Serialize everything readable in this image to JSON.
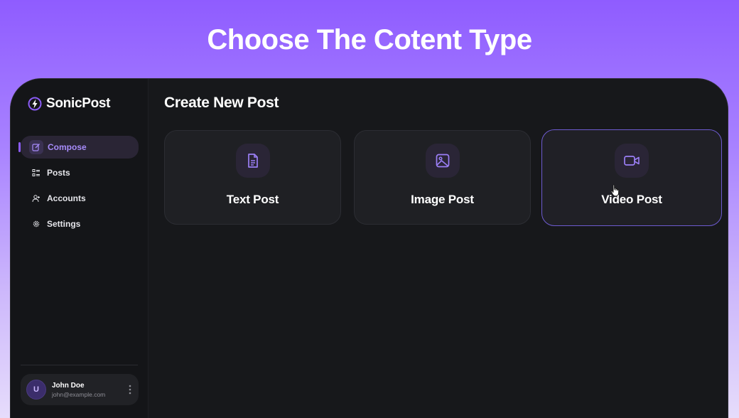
{
  "hero": {
    "title": "Choose The Cotent Type"
  },
  "brand": {
    "name": "SonicPost"
  },
  "nav": {
    "items": [
      {
        "label": "Compose",
        "icon": "edit-icon",
        "active": true
      },
      {
        "label": "Posts",
        "icon": "grid-list-icon",
        "active": false
      },
      {
        "label": "Accounts",
        "icon": "user-plus-icon",
        "active": false
      },
      {
        "label": "Settings",
        "icon": "gear-icon",
        "active": false
      }
    ]
  },
  "user": {
    "initial": "U",
    "name": "John Doe",
    "email": "john@example.com"
  },
  "main": {
    "title": "Create New Post",
    "cards": [
      {
        "label": "Text Post",
        "icon": "document-icon",
        "selected": false
      },
      {
        "label": "Image Post",
        "icon": "image-icon",
        "selected": false
      },
      {
        "label": "Video Post",
        "icon": "video-camera-icon",
        "selected": true
      }
    ]
  },
  "colors": {
    "accent": "#8b5cf6",
    "background": "#17181b",
    "card": "#1f2024"
  }
}
